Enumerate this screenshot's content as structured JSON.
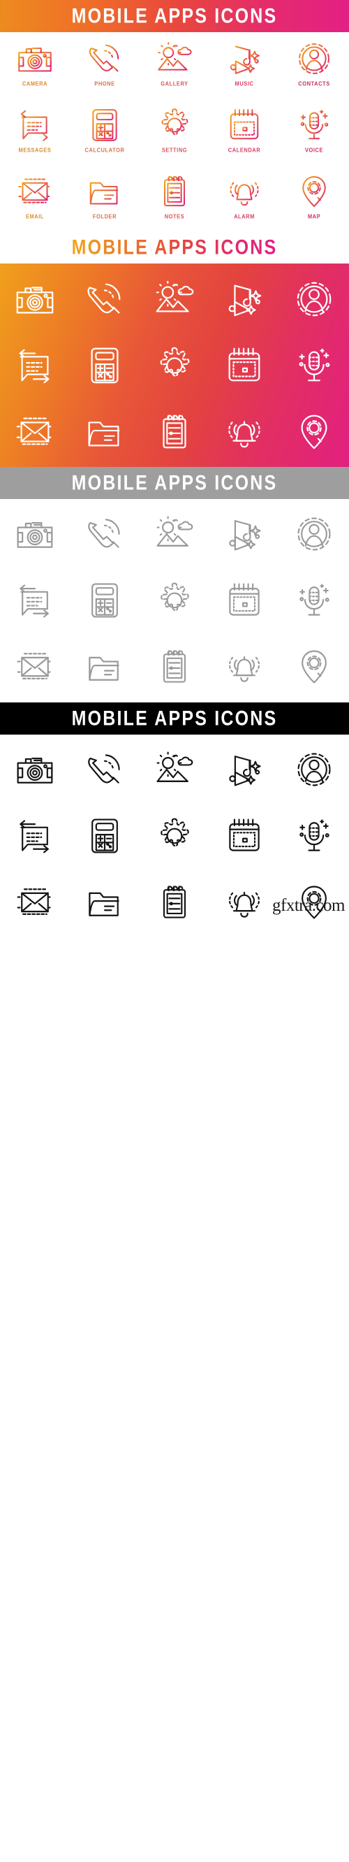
{
  "page": {
    "title": "Mobile Apps Icons",
    "watermark": "gfxtra.com"
  },
  "colors": {
    "gradient_start": "#ED8B1F",
    "gradient_mid": "#E8453F",
    "gradient_end": "#E32084",
    "gray_banner": "#9e9e9e",
    "gray_icon": "#9a9a9a",
    "black": "#000000",
    "white": "#ffffff"
  },
  "sections": [
    {
      "id": "section-colored-on-white",
      "banner": {
        "text": "MOBILE APPS ICONS",
        "style": "gradient-bar-white-text"
      },
      "background": "white",
      "icon_style": "gradient-stroke",
      "show_labels": true
    },
    {
      "id": "section-white-on-gradient",
      "banner": {
        "text": "MOBILE APPS ICONS",
        "style": "white-bar-gradient-text"
      },
      "background": "gradient",
      "icon_style": "white-stroke",
      "show_labels": false
    },
    {
      "id": "section-gray-on-white",
      "banner": {
        "text": "MOBILE APPS ICONS",
        "style": "gray-bar-white-text"
      },
      "background": "white",
      "icon_style": "gray-stroke",
      "show_labels": false
    },
    {
      "id": "section-black-on-white",
      "banner": {
        "text": "MOBILE APPS ICONS",
        "style": "black-bar-white-text"
      },
      "background": "white",
      "icon_style": "black-stroke",
      "show_labels": false
    }
  ],
  "icons": [
    {
      "key": "camera",
      "label": "CAMERA",
      "icon_name": "camera-icon",
      "row": 1,
      "col": 1,
      "label_color": "#E08A2B"
    },
    {
      "key": "phone",
      "label": "PHONE",
      "icon_name": "phone-icon",
      "row": 1,
      "col": 2,
      "label_color": "#DE6F48"
    },
    {
      "key": "gallery",
      "label": "GALLERY",
      "icon_name": "gallery-icon",
      "row": 1,
      "col": 3,
      "label_color": "#DE5255"
    },
    {
      "key": "music",
      "label": "MUSIC",
      "icon_name": "music-icon",
      "row": 1,
      "col": 4,
      "label_color": "#D93F63"
    },
    {
      "key": "contacts",
      "label": "CONTACTS",
      "icon_name": "contacts-icon",
      "row": 1,
      "col": 5,
      "label_color": "#C9325F"
    },
    {
      "key": "messages",
      "label": "MESSAGES",
      "icon_name": "messages-icon",
      "row": 2,
      "col": 1,
      "label_color": "#D98C2E"
    },
    {
      "key": "calculator",
      "label": "CALCULATOR",
      "icon_name": "calculator-icon",
      "row": 2,
      "col": 2,
      "label_color": "#D7714A"
    },
    {
      "key": "setting",
      "label": "SETTING",
      "icon_name": "settings-gear-icon",
      "row": 2,
      "col": 3,
      "label_color": "#D85557"
    },
    {
      "key": "calendar",
      "label": "CALENDAR",
      "icon_name": "calendar-icon",
      "row": 2,
      "col": 4,
      "label_color": "#D44065"
    },
    {
      "key": "voice",
      "label": "VOICE",
      "icon_name": "microphone-icon",
      "row": 2,
      "col": 5,
      "label_color": "#C73360"
    },
    {
      "key": "email",
      "label": "EMAIL",
      "icon_name": "email-envelope-icon",
      "row": 3,
      "col": 1,
      "label_color": "#D59030"
    },
    {
      "key": "folder",
      "label": "FOLDER",
      "icon_name": "folder-icon",
      "row": 3,
      "col": 2,
      "label_color": "#D4744B"
    },
    {
      "key": "notes",
      "label": "NOTES",
      "icon_name": "notes-clipboard-icon",
      "row": 3,
      "col": 3,
      "label_color": "#D45758"
    },
    {
      "key": "alarm",
      "label": "ALARM",
      "icon_name": "alarm-bell-icon",
      "row": 3,
      "col": 4,
      "label_color": "#D14166"
    },
    {
      "key": "map",
      "label": "MAP",
      "icon_name": "map-pin-icon",
      "row": 3,
      "col": 5,
      "label_color": "#C53461"
    }
  ]
}
